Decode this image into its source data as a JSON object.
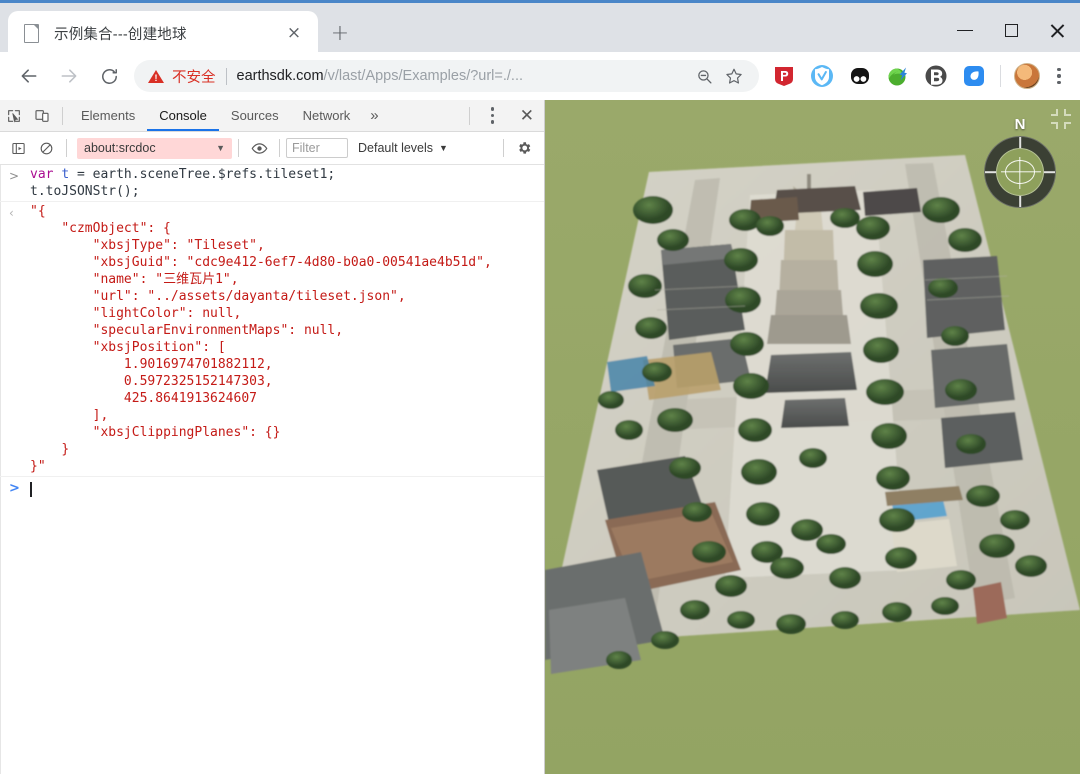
{
  "window": {
    "controls": {
      "minimize": "minimize",
      "maximize": "maximize",
      "close": "close"
    }
  },
  "browser": {
    "tab": {
      "title": "示例集合---创建地球",
      "favicon": "document-icon",
      "close_label": "×"
    },
    "new_tab_label": "+",
    "nav": {
      "back": "←",
      "forward": "→",
      "reload": "⟳"
    },
    "omnibox": {
      "security_label": "不安全",
      "security_icon": "warning-triangle-icon",
      "url_host": "earthsdk.com",
      "url_path": "/v/last/Apps/Examples/?url=./...",
      "url_full": "earthsdk.com/v/last/Apps/Examples/?url=./...",
      "zoom_icon": "search-minus-icon",
      "bookmark_icon": "star-icon"
    },
    "extensions": [
      {
        "name": "extension-pdf",
        "color": "#d22630"
      },
      {
        "name": "extension-v-shield",
        "color": "#4aaef0"
      },
      {
        "name": "extension-dual-dot",
        "color": "#111111"
      },
      {
        "name": "extension-download-manager",
        "color": "#4ba32f"
      },
      {
        "name": "extension-bitbrowser",
        "color": "#4a4a4a"
      },
      {
        "name": "extension-blue-leaf",
        "color": "#2d8cf0"
      }
    ],
    "profile_avatar": "user-avatar",
    "menu_icon": "kebab-menu-icon"
  },
  "devtools": {
    "inspect_icon": "inspect-element-icon",
    "device_icon": "device-toolbar-icon",
    "tabs": [
      {
        "label": "Elements",
        "active": false
      },
      {
        "label": "Console",
        "active": true
      },
      {
        "label": "Sources",
        "active": false
      },
      {
        "label": "Network",
        "active": false
      }
    ],
    "more_tabs_label": "»",
    "settings_icon": "dots-vertical-icon",
    "close_label": "✕",
    "filterbar": {
      "sidebar_icon": "console-sidebar-icon",
      "clear_icon": "clear-console-icon",
      "context": "about:srcdoc",
      "context_caret": "▼",
      "eye_icon": "live-expression-eye-icon",
      "filter_placeholder": "Filter",
      "levels_label": "Default levels",
      "levels_caret": "▼",
      "gear_icon": "settings-gear-icon"
    },
    "console": {
      "input_gutter": ">",
      "output_gutter": "‹",
      "prompt_gutter": ">",
      "input_lines": [
        "var t = earth.sceneTree.$refs.tileset1;",
        "t.toJSONStr();"
      ],
      "input_tokens": {
        "keyword": "var",
        "variable": "t",
        "rest_line1": " = earth.sceneTree.$refs.tileset1;",
        "line2": "t.toJSONStr();"
      },
      "output_text": "\"{\n    \"czmObject\": {\n        \"xbsjType\": \"Tileset\",\n        \"xbsjGuid\": \"cdc9e412-6ef7-4d80-b0a0-00541ae4b51d\",\n        \"name\": \"三维瓦片1\",\n        \"url\": \"../assets/dayanta/tileset.json\",\n        \"lightColor\": null,\n        \"specularEnvironmentMaps\": null,\n        \"xbsjPosition\": [\n            1.9016974701882112,\n            0.5972325152147303,\n            425.8641913624607\n        ],\n        \"xbsjClippingPlanes\": {}\n    }\n}\"",
      "output_object": {
        "czmObject": {
          "xbsjType": "Tileset",
          "xbsjGuid": "cdc9e412-6ef7-4d80-b0a0-00541ae4b51d",
          "name": "三维瓦片1",
          "url": "../assets/dayanta/tileset.json",
          "lightColor": null,
          "specularEnvironmentMaps": null,
          "xbsjPosition": [
            1.9016974701882112,
            0.5972325152147303,
            425.8641913624607
          ],
          "xbsjClippingPlanes": {}
        }
      }
    }
  },
  "viewport": {
    "background_color": "#97a866",
    "compass": {
      "north_label": "N",
      "name": "compass-navigation-widget"
    },
    "collapse_icon": "collapse-fullscreen-icon",
    "scene_description": "3D photogrammetry tileset of Giant Wild Goose Pagoda complex"
  },
  "colors": {
    "accent": "#1a73e8",
    "danger": "#d93025",
    "string": "#c41a16",
    "keyword": "#aa0d91",
    "variable": "#3a5fcd",
    "viewport_bg": "#97a866"
  }
}
